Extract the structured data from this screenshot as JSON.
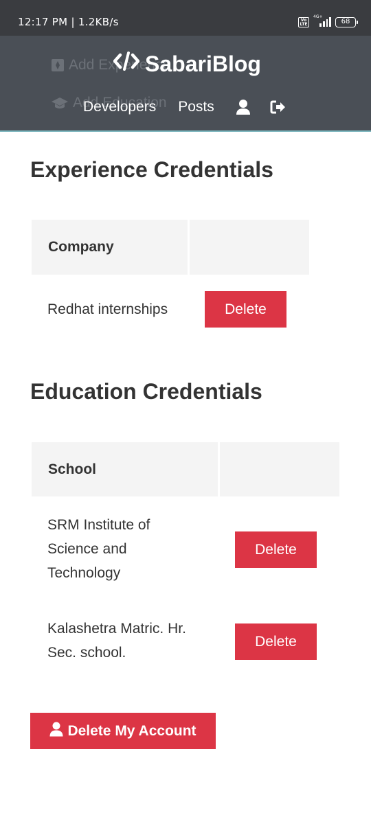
{
  "status_bar": {
    "time": "12:17 PM | 1.2KB/s",
    "volte": "Vo LTE",
    "network": "4G+",
    "battery": "68"
  },
  "navbar": {
    "brand": "SabariBlog",
    "links": [
      "Developers",
      "Posts"
    ],
    "ghost_items": [
      "Add Experience",
      "Add Education"
    ]
  },
  "experience": {
    "title": "Experience Credentials",
    "header": "Company",
    "rows": [
      {
        "company": "Redhat internships",
        "action": "Delete"
      }
    ]
  },
  "education": {
    "title": "Education Credentials",
    "header": "School",
    "rows": [
      {
        "school_lines": [
          "SRM Institute of",
          "Science and",
          "Technology"
        ],
        "action": "Delete"
      },
      {
        "school_lines": [
          "Kalashetra Matric. Hr.",
          "Sec. school."
        ],
        "action": "Delete"
      }
    ]
  },
  "delete_account": "Delete My Account",
  "colors": {
    "navbar": "#4a4f56",
    "danger": "#dc3545",
    "table_header": "#f4f4f4"
  }
}
